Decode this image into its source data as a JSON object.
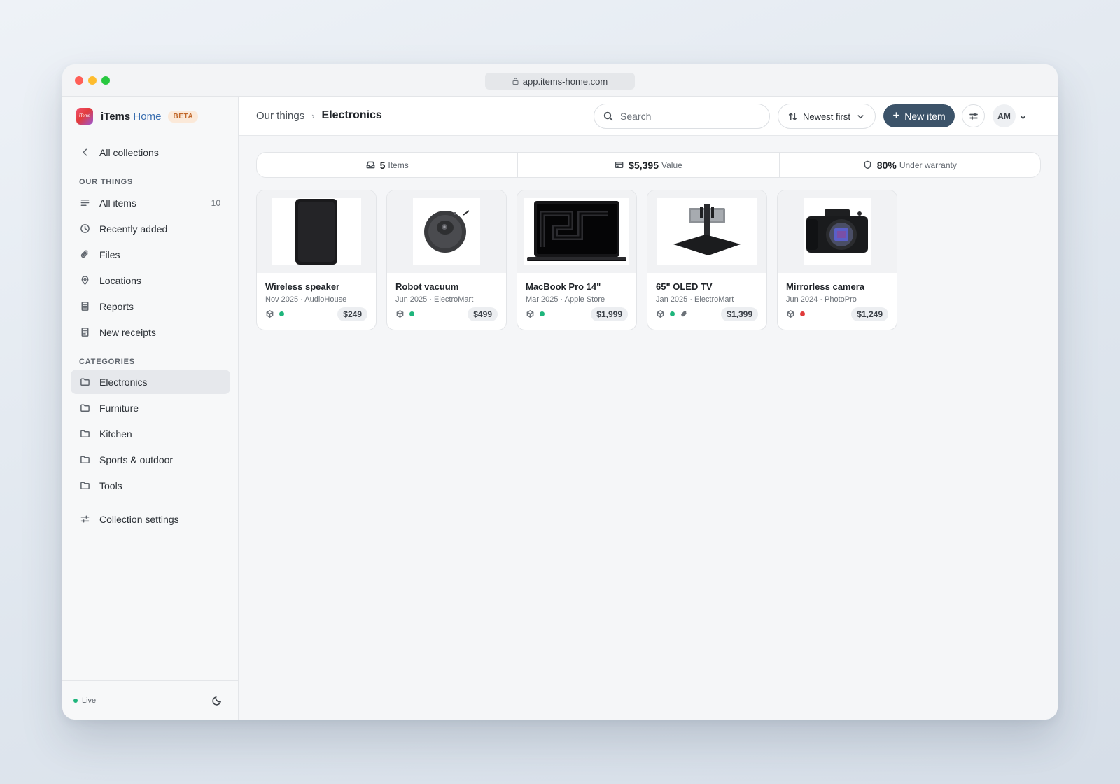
{
  "browser": {
    "url": "app.items-home.com"
  },
  "brand": {
    "name_part1": "iTems",
    "name_part2": " Home",
    "badge": "BETA",
    "logo_text": "iTems"
  },
  "sidebar": {
    "back_label": "All collections",
    "sections": {
      "our_things": "OUR THINGS",
      "categories": "CATEGORIES"
    },
    "our_things_items": [
      {
        "label": "All items",
        "count": "10",
        "icon": "list-icon"
      },
      {
        "label": "Recently added",
        "icon": "clock-icon"
      },
      {
        "label": "Files",
        "icon": "paperclip-icon"
      },
      {
        "label": "Locations",
        "icon": "map-pin-icon"
      },
      {
        "label": "Reports",
        "icon": "document-icon"
      },
      {
        "label": "New receipts",
        "icon": "receipt-icon"
      }
    ],
    "categories": [
      {
        "label": "Electronics",
        "active": true,
        "icon": "folder-icon"
      },
      {
        "label": "Furniture",
        "icon": "folder-icon"
      },
      {
        "label": "Kitchen",
        "icon": "folder-icon"
      },
      {
        "label": "Sports & outdoor",
        "icon": "folder-icon"
      },
      {
        "label": "Tools",
        "icon": "folder-icon"
      }
    ],
    "settings_label": "Collection settings",
    "footer": {
      "status": "Live",
      "status_color": "#1fb57c"
    }
  },
  "header": {
    "breadcrumb_parent": "Our things",
    "breadcrumb_current": "Electronics",
    "search_placeholder": "Search",
    "sort_label": "Newest first",
    "new_item_label": "New item",
    "avatar_initials": "AM"
  },
  "stats": [
    {
      "value": "5",
      "label": "Items",
      "icon": "inbox-icon"
    },
    {
      "value": "$5,395",
      "label": "Value",
      "icon": "credit-card-icon"
    },
    {
      "value": "80%",
      "label": "Under warranty",
      "icon": "shield-icon"
    }
  ],
  "items": [
    {
      "title": "Wireless speaker",
      "meta": "Nov 2025 · AudioHouse",
      "price": "$249",
      "status_color": "#1fb57c",
      "has_attachment": false
    },
    {
      "title": "Robot vacuum",
      "meta": "Jun 2025 · ElectroMart",
      "price": "$499",
      "status_color": "#1fb57c",
      "has_attachment": false
    },
    {
      "title": "MacBook Pro 14\"",
      "meta": "Mar 2025 · Apple Store",
      "price": "$1,999",
      "status_color": "#1fb57c",
      "has_attachment": false
    },
    {
      "title": "65\" OLED TV",
      "meta": "Jan 2025 · ElectroMart",
      "price": "$1,399",
      "status_color": "#1fb57c",
      "has_attachment": true
    },
    {
      "title": "Mirrorless camera",
      "meta": "Jun 2024 · PhotoPro",
      "price": "$1,249",
      "status_color": "#e03b3b",
      "has_attachment": false
    }
  ],
  "colors": {
    "accent": "#3c5369",
    "beta_text": "#c0672a",
    "beta_bg": "#fbe9d9"
  }
}
